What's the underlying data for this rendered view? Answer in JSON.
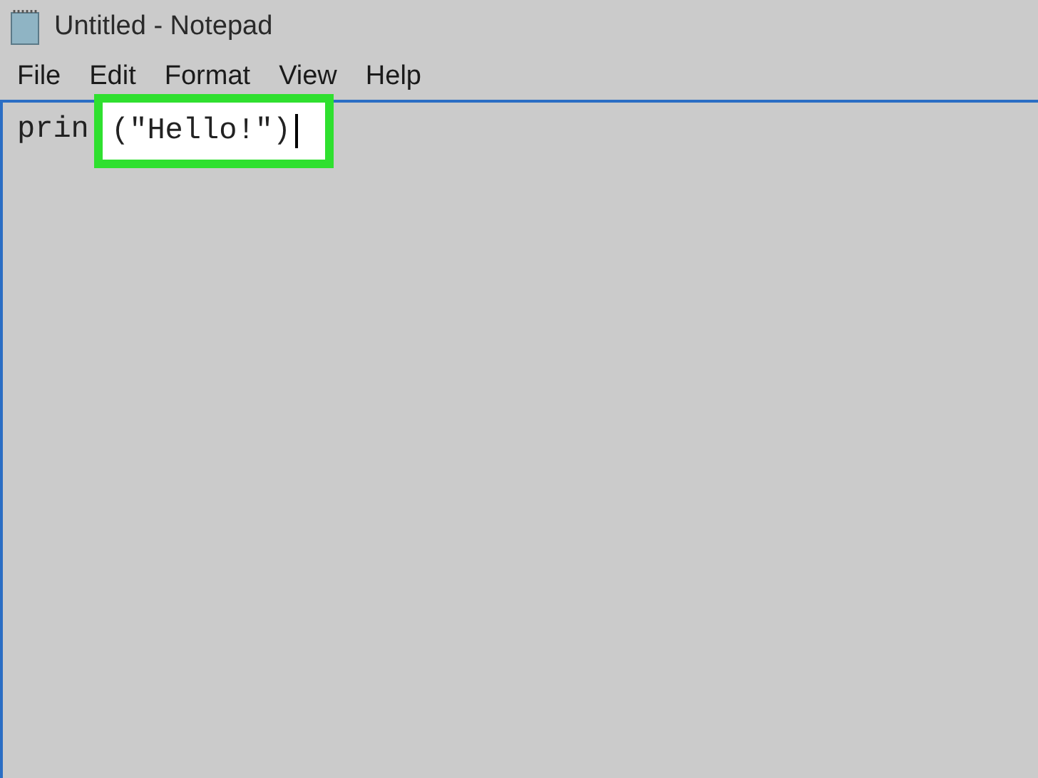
{
  "window": {
    "title": "Untitled - Notepad"
  },
  "menu": [
    "File",
    "Edit",
    "Format",
    "View",
    "Help"
  ],
  "editor": {
    "text": "prin",
    "highlight": {
      "text": "(\"Hello!\")",
      "caret": true
    }
  }
}
